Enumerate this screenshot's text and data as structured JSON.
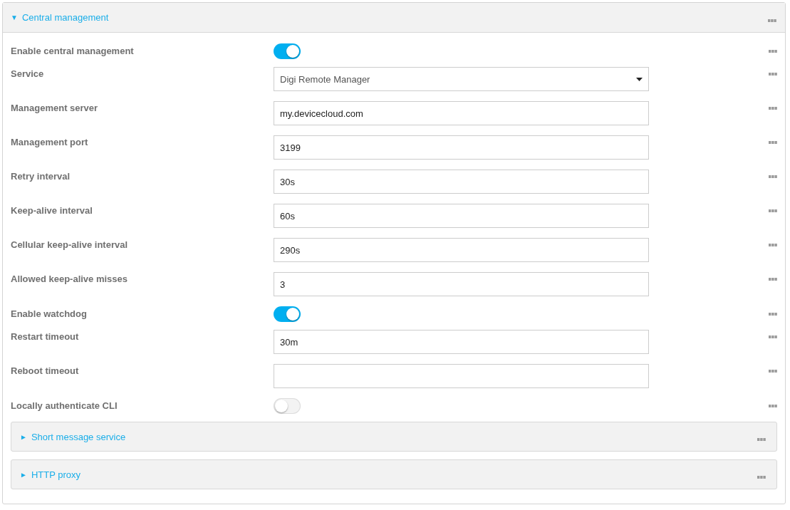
{
  "panel": {
    "title": "Central management",
    "expander": "▼"
  },
  "fields": [
    {
      "kind": "toggle",
      "label": "Enable central management",
      "on": true
    },
    {
      "kind": "select",
      "label": "Service",
      "value": "Digi Remote Manager"
    },
    {
      "kind": "text",
      "label": "Management server",
      "value": "my.devicecloud.com"
    },
    {
      "kind": "text",
      "label": "Management port",
      "value": "3199"
    },
    {
      "kind": "text",
      "label": "Retry interval",
      "value": "30s"
    },
    {
      "kind": "text",
      "label": "Keep-alive interval",
      "value": "60s"
    },
    {
      "kind": "text",
      "label": "Cellular keep-alive interval",
      "value": "290s"
    },
    {
      "kind": "text",
      "label": "Allowed keep-alive misses",
      "value": "3"
    },
    {
      "kind": "toggle",
      "label": "Enable watchdog",
      "on": true
    },
    {
      "kind": "text",
      "label": "Restart timeout",
      "value": "30m"
    },
    {
      "kind": "text",
      "label": "Reboot timeout"
    },
    {
      "kind": "toggle",
      "label": "Locally authenticate CLI",
      "on": false
    }
  ],
  "subsections": [
    {
      "title": "Short message service",
      "expander": "►"
    },
    {
      "title": "HTTP proxy",
      "expander": "►"
    }
  ]
}
